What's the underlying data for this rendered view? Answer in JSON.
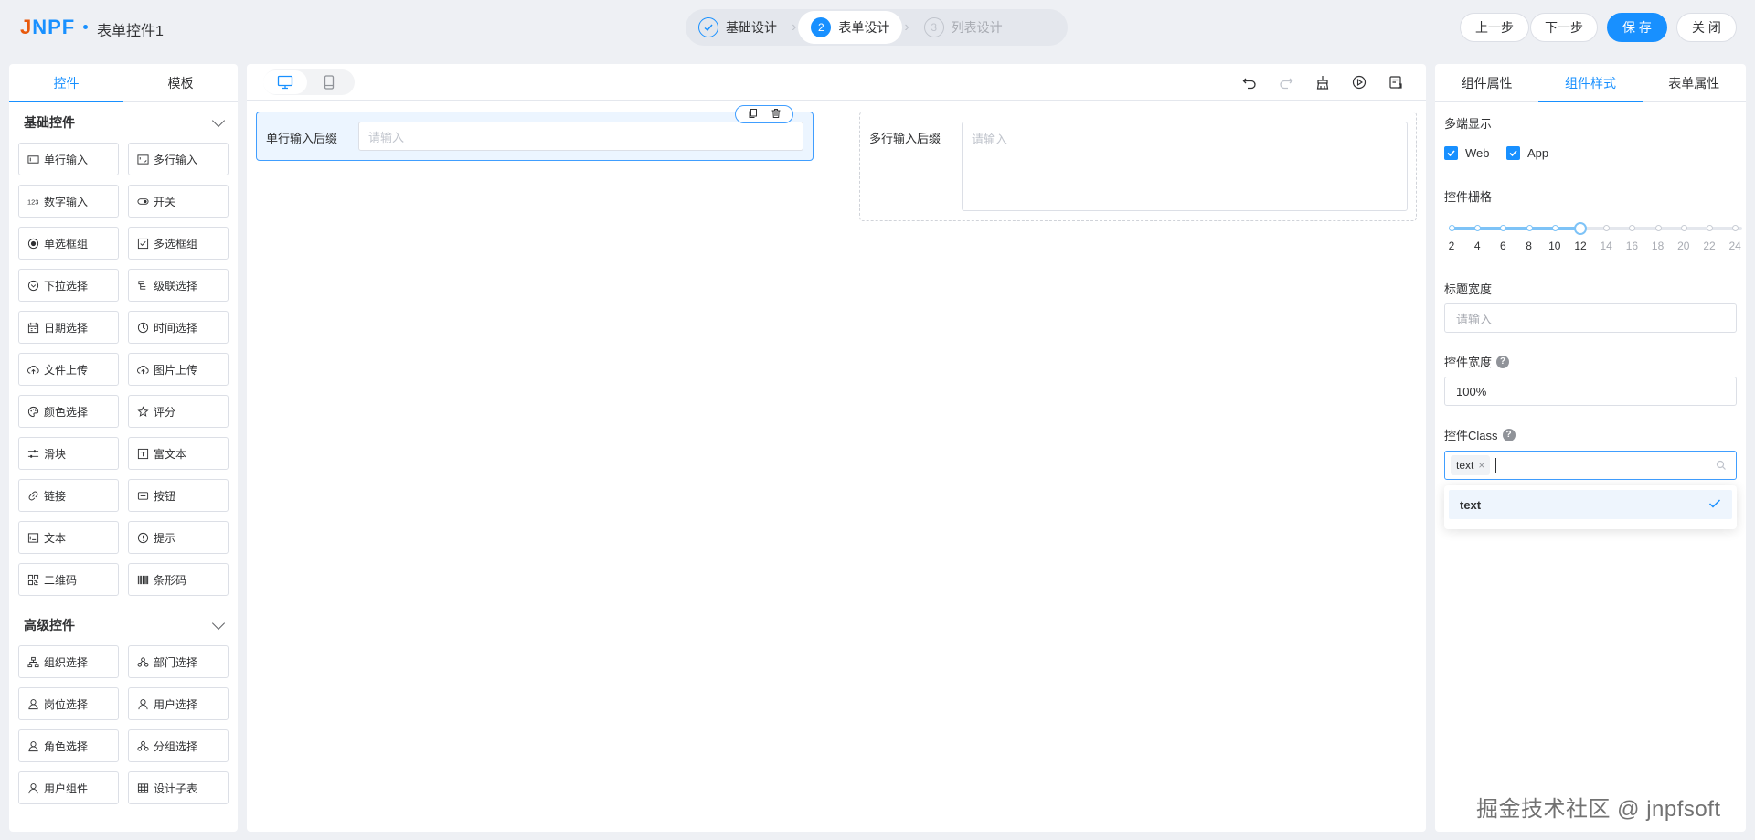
{
  "header": {
    "logo_part1": "J",
    "logo_part2": "NPF",
    "form_title": "表单控件1",
    "steps": [
      {
        "num": "",
        "label": "基础设计",
        "state": "done"
      },
      {
        "num": "2",
        "label": "表单设计",
        "state": "active"
      },
      {
        "num": "3",
        "label": "列表设计",
        "state": "todo"
      }
    ],
    "buttons": {
      "prev": "上一步",
      "next": "下一步",
      "save": "保 存",
      "close": "关 闭"
    }
  },
  "left": {
    "tabs": [
      "控件",
      "模板"
    ],
    "basic_title": "基础控件",
    "basic_items": [
      {
        "label": "单行输入",
        "icon": "input-icon"
      },
      {
        "label": "多行输入",
        "icon": "textarea-icon"
      },
      {
        "label": "数字输入",
        "icon": "number-icon"
      },
      {
        "label": "开关",
        "icon": "switch-icon"
      },
      {
        "label": "单选框组",
        "icon": "radio-icon"
      },
      {
        "label": "多选框组",
        "icon": "checkbox-icon"
      },
      {
        "label": "下拉选择",
        "icon": "select-icon"
      },
      {
        "label": "级联选择",
        "icon": "cascader-icon"
      },
      {
        "label": "日期选择",
        "icon": "calendar-icon"
      },
      {
        "label": "时间选择",
        "icon": "clock-icon"
      },
      {
        "label": "文件上传",
        "icon": "upload-icon"
      },
      {
        "label": "图片上传",
        "icon": "image-upload-icon"
      },
      {
        "label": "颜色选择",
        "icon": "palette-icon"
      },
      {
        "label": "评分",
        "icon": "star-icon"
      },
      {
        "label": "滑块",
        "icon": "slider-icon"
      },
      {
        "label": "富文本",
        "icon": "richtext-icon"
      },
      {
        "label": "链接",
        "icon": "link-icon"
      },
      {
        "label": "按钮",
        "icon": "button-icon"
      },
      {
        "label": "文本",
        "icon": "text-icon"
      },
      {
        "label": "提示",
        "icon": "alert-icon"
      },
      {
        "label": "二维码",
        "icon": "qrcode-icon"
      },
      {
        "label": "条形码",
        "icon": "barcode-icon"
      }
    ],
    "advanced_title": "高级控件",
    "advanced_items": [
      {
        "label": "组织选择",
        "icon": "org-icon"
      },
      {
        "label": "部门选择",
        "icon": "dept-icon"
      },
      {
        "label": "岗位选择",
        "icon": "position-icon"
      },
      {
        "label": "用户选择",
        "icon": "user-icon"
      },
      {
        "label": "角色选择",
        "icon": "role-icon"
      },
      {
        "label": "分组选择",
        "icon": "group-icon"
      },
      {
        "label": "用户组件",
        "icon": "user-component-icon"
      },
      {
        "label": "设计子表",
        "icon": "table-icon"
      }
    ]
  },
  "canvas": {
    "item1": {
      "label": "单行输入后缀",
      "placeholder": "请输入"
    },
    "item2": {
      "label": "多行输入后缀",
      "placeholder": "请输入"
    }
  },
  "right": {
    "tabs": [
      "组件属性",
      "组件样式",
      "表单属性"
    ],
    "multi_display_label": "多端显示",
    "web_label": "Web",
    "app_label": "App",
    "grid_label": "控件栅格",
    "grid_ticks": [
      "2",
      "4",
      "6",
      "8",
      "10",
      "12",
      "14",
      "16",
      "18",
      "20",
      "22",
      "24"
    ],
    "grid_value": 12,
    "title_width_label": "标题宽度",
    "title_width_placeholder": "请输入",
    "control_width_label": "控件宽度",
    "control_width_value": "100%",
    "control_class_label": "控件Class",
    "class_tag": "text",
    "class_option": "text"
  },
  "watermark": "掘金技术社区 @ jnpfsoft",
  "colors": {
    "accent": "#1890ff",
    "logo_orange": "#e8590c"
  }
}
